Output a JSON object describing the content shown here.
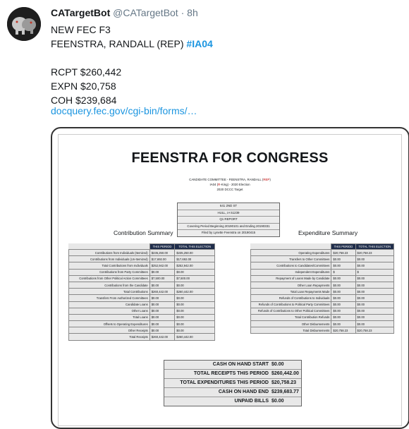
{
  "tweet": {
    "display_name": "CATargetBot",
    "handle": "@CATargetBot",
    "separator": "·",
    "time": "8h",
    "line1": "NEW FEC F3",
    "line2_prefix": "FEENSTRA, RANDALL (REP) ",
    "hashtag": "#IA04",
    "rcpt": "RCPT $260,442",
    "expn": "EXPN $20,758",
    "coh": "COH $239,684",
    "link": "docquery.fec.gov/cgi-bin/forms/…"
  },
  "doc": {
    "title": "FEENSTRA FOR CONGRESS",
    "cand_prefix": "CANDIDATE COMMITTEE - FEENSTRA, RANDALL (",
    "cand_party": "REP",
    "cand_suffix": ")",
    "district_prefix": "IA04 (",
    "district_party": "R",
    "district_suffix": "-King) - 2020 Election",
    "target": "2020 DCCC Target",
    "address": [
      "641 2ND ST",
      "HULL, IA 51239",
      "Q1 REPORT",
      "Covering Period Beginning 20190101 and Ending 20190331",
      "Filed by Lynette Feenstra on 20190415"
    ],
    "contrib_title": "Contribution Summary",
    "expend_title": "Expenditure Summary",
    "col_this_period": "THIS PERIOD",
    "col_this_election": "TOTAL THIS ELECTION",
    "contrib_rows": [
      [
        "Contributions from Individuals (Itemized)",
        "$235,250.00",
        "$235,250.00"
      ],
      [
        "Contributions from Individuals (Un-Itemized)",
        "$17,692.00",
        "$17,692.00"
      ],
      [
        "Total Contributions from Individuals",
        "$252,942.00",
        "$252,942.00"
      ],
      [
        "Contributions from Party Committees",
        "$0.00",
        "$0.00"
      ],
      [
        "Contributions from Other Political Action Committees",
        "$7,500.00",
        "$7,500.00"
      ],
      [
        "Contributions from the Candidate",
        "$0.00",
        "$0.00"
      ],
      [
        "Total Contributions",
        "$260,442.00",
        "$260,442.00"
      ],
      [
        "Transfers From Authorized Committees",
        "$0.00",
        "$0.00"
      ],
      [
        "Candidate Loans",
        "$0.00",
        "$0.00"
      ],
      [
        "Other Loans",
        "$0.00",
        "$0.00"
      ],
      [
        "Total Loans",
        "$0.00",
        "$0.00"
      ],
      [
        "Offsets to Operating Expenditures",
        "$0.00",
        "$0.00"
      ],
      [
        "Other Receipts",
        "$0.00",
        "$0.00"
      ],
      [
        "Total Receipts",
        "$260,442.00",
        "$260,442.00"
      ]
    ],
    "expend_rows": [
      [
        "Operating Expenditures",
        "$20,758.23",
        "$20,758.23"
      ],
      [
        "Transfers to Other Committees",
        "$0.00",
        "$0.00"
      ],
      [
        "Contributions to Candidates/Committees",
        "$0.00",
        "$0.00"
      ],
      [
        "Independent Expenditures",
        "$",
        "$"
      ],
      [
        "Repayment of Loans Made by Candidate",
        "$0.00",
        "$0.00"
      ],
      [
        "Other Loan Repayments",
        "$0.00",
        "$0.00"
      ],
      [
        "Total Loan Repayments Made",
        "$0.00",
        "$0.00"
      ],
      [
        "Refunds of Contributions to Individuals",
        "$0.00",
        "$0.00"
      ],
      [
        "Refunds of Contributions to Political Party Committees",
        "$0.00",
        "$0.00"
      ],
      [
        "Refunds of Contributions to Other Political Committees",
        "$0.00",
        "$0.00"
      ],
      [
        "Total Contribution Refunds",
        "$0.00",
        "$0.00"
      ],
      [
        "Other Disbursements",
        "$0.00",
        "$0.00"
      ],
      [
        "Total Disbursements",
        "$20,758.23",
        "$20,758.23"
      ]
    ],
    "cash": [
      [
        "CASH ON HAND START",
        "$0.00"
      ],
      [
        "TOTAL RECEIPTS THIS PERIOD",
        "$260,442.00"
      ],
      [
        "TOTAL EXPENDITURES THIS PERIOD",
        "$20,758.23"
      ],
      [
        "CASH ON HAND END",
        "$239,683.77"
      ],
      [
        "UNPAID BILLS",
        "$0.00"
      ]
    ]
  }
}
